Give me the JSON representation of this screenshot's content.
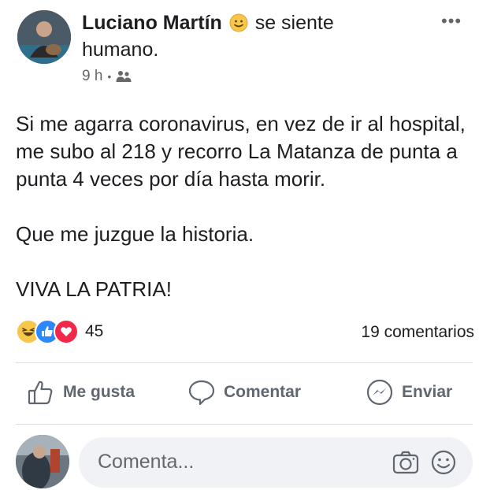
{
  "post": {
    "author": "Luciano Martín",
    "feeling_text": "se siente",
    "feeling_value": "humano.",
    "time": "9 h",
    "separator": "•",
    "audience_icon": "friends-icon",
    "paragraphs": [
      "Si me agarra coronavirus, en vez de ir al hospital, me subo al 218 y recorro La Matanza de punta a punta 4 veces por día hasta morir.",
      "Que me juzgue la historia.",
      "VIVA LA PATRIA!"
    ],
    "more_label": "•••"
  },
  "reactions": {
    "types": [
      "haha",
      "like",
      "love"
    ],
    "count": "45"
  },
  "comments_count": "19 comentarios",
  "actions": {
    "like": "Me gusta",
    "comment": "Comentar",
    "share": "Enviar"
  },
  "composer": {
    "placeholder": "Comenta..."
  },
  "colors": {
    "like_blue": "#2d88ff",
    "love_red": "#f0284a",
    "haha_yellow": "#f7c64a",
    "secondary_text": "#65676b"
  }
}
